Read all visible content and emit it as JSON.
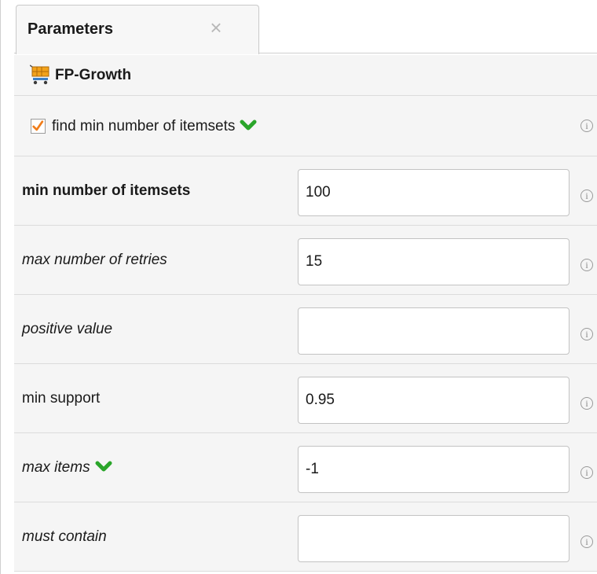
{
  "tab": {
    "label": "Parameters",
    "close_icon": "close-icon"
  },
  "operator": {
    "name": "FP-Growth",
    "icon": "shopping-cart-icon"
  },
  "colors": {
    "checkmark": "#f07d1a",
    "chevron": "#2aa52a",
    "row_background": "#f5f5f5",
    "border": "#dcdcdc"
  },
  "checkbox_param": {
    "label": "find min number of itemsets",
    "checked": true,
    "expand_icon": "chevron-down-icon",
    "info_icon": "info-icon"
  },
  "params": [
    {
      "label": "min number of itemsets",
      "value": "100",
      "style": "bold",
      "info_icon": "info-icon"
    },
    {
      "label": "max number of retries",
      "value": "15",
      "style": "italic",
      "info_icon": "info-icon"
    },
    {
      "label": "positive value",
      "value": "",
      "style": "italic",
      "info_icon": "info-icon"
    },
    {
      "label": "min support",
      "value": "0.95",
      "style": "normal",
      "info_icon": "info-icon"
    },
    {
      "label": "max items",
      "value": "-1",
      "style": "italic",
      "expand_icon": "chevron-down-icon",
      "info_icon": "info-icon"
    },
    {
      "label": "must contain",
      "value": "",
      "style": "italic",
      "info_icon": "info-icon"
    }
  ]
}
